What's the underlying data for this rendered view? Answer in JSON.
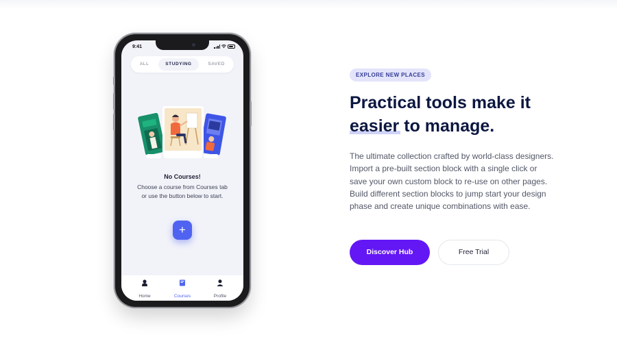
{
  "phone": {
    "status_bar": {
      "time": "9:41"
    },
    "tabs": [
      {
        "label": "ALL",
        "active": false
      },
      {
        "label": "STUDYING",
        "active": true
      },
      {
        "label": "SAVED",
        "active": false
      }
    ],
    "empty_state": {
      "title": "No Courses!",
      "message": "Choose a course from Courses tab or use the button below to start."
    },
    "add_button": {
      "icon": "plus-icon",
      "label": "+"
    },
    "bottom_nav": [
      {
        "label": "Home",
        "icon": "home-icon",
        "active": false
      },
      {
        "label": "Courses",
        "icon": "book-icon",
        "active": true
      },
      {
        "label": "Profile",
        "icon": "person-icon",
        "active": false
      }
    ]
  },
  "hero": {
    "badge": "EXPLORE NEW PLACES",
    "headline": {
      "part1": "Practical tools make it",
      "highlight": "easier",
      "part2": "to manage."
    },
    "body": "The ultimate collection crafted by world-class designers. Import a pre-built section block with a single click or save your own custom block to re-use on other pages. Build different section blocks to jump start your design phase and create unique combinations with ease.",
    "primary_button": "Discover Hub",
    "secondary_button": "Free Trial"
  },
  "colors": {
    "accent": "#6417f5",
    "app_accent": "#4f63f0",
    "heading": "#0c1740",
    "badge_bg": "#e3e4fb"
  }
}
